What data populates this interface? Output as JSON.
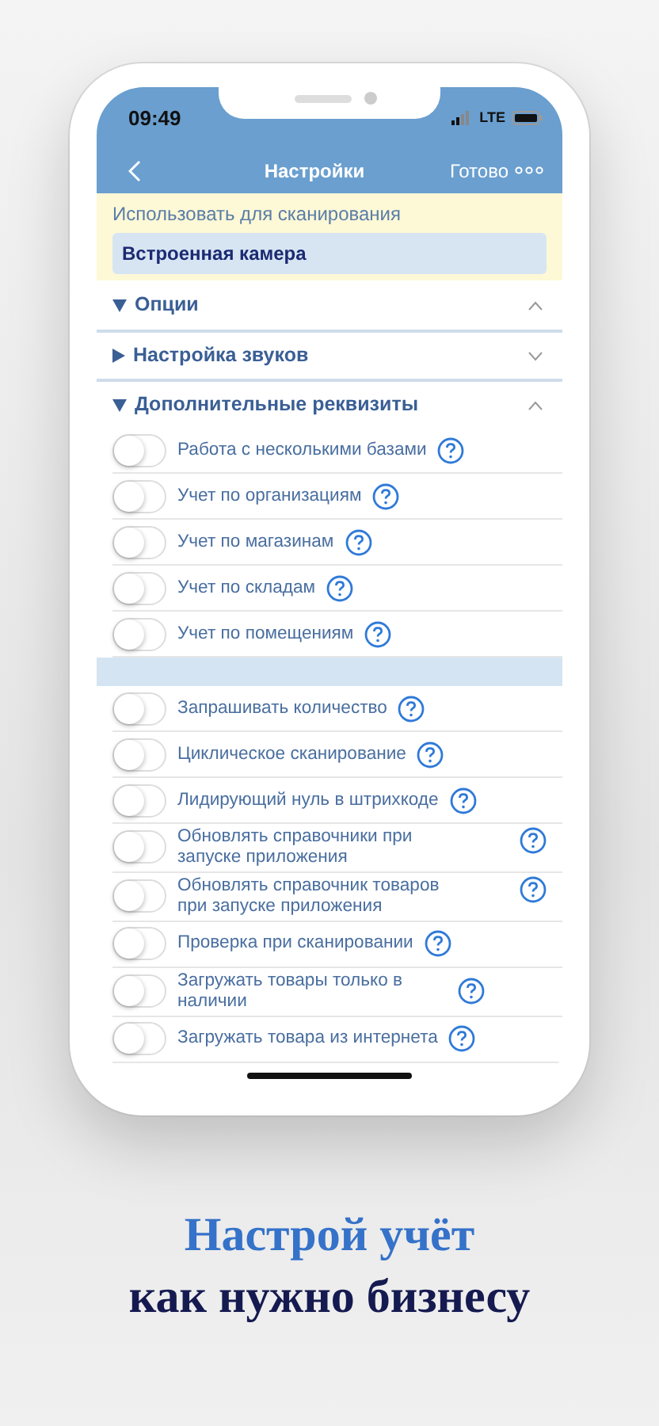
{
  "status_bar": {
    "time": "09:49",
    "network": "LTE"
  },
  "nav": {
    "title": "Настройки",
    "done": "Готово"
  },
  "scanner": {
    "label": "Использовать для сканирования",
    "value": "Встроенная камера"
  },
  "sections": [
    {
      "title": "Опции",
      "expanded": true
    },
    {
      "title": "Настройка звуков",
      "expanded": false
    },
    {
      "title": "Дополнительные реквизиты",
      "expanded": true,
      "groups": [
        [
          {
            "label": "Работа с несколькими базами",
            "on": false
          },
          {
            "label": "Учет по организациям",
            "on": false
          },
          {
            "label": "Учет по магазинам",
            "on": false
          },
          {
            "label": "Учет по складам",
            "on": false
          },
          {
            "label": "Учет по помещениям",
            "on": false
          }
        ],
        [
          {
            "label": "Запрашивать количество",
            "on": false
          },
          {
            "label": "Циклическое сканирование",
            "on": false
          },
          {
            "label": "Лидирующий нуль в штрихкоде",
            "on": false
          },
          {
            "label": "Обновлять справочники при запуске приложения",
            "on": false
          },
          {
            "label": "Обновлять справочник товаров при запуске приложения",
            "on": false
          },
          {
            "label": "Проверка при сканировании",
            "on": false
          },
          {
            "label": "Загружать товары только в наличии",
            "on": false
          },
          {
            "label": "Загружать товара из интернета",
            "on": false
          }
        ]
      ]
    }
  ],
  "headline": [
    "Настрой учёт",
    "как нужно бизнесу"
  ]
}
